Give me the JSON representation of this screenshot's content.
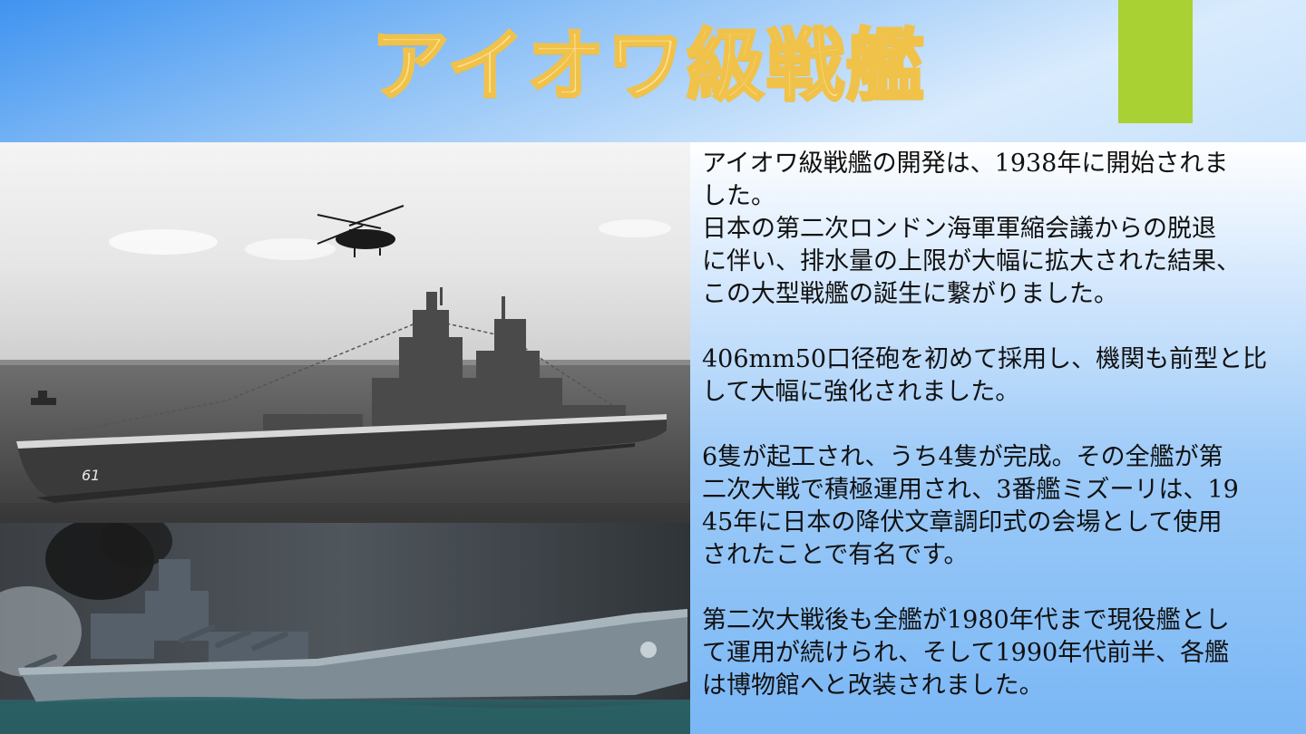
{
  "slide": {
    "title": "アイオワ級戦艦",
    "paragraphs": [
      [
        "アイオワ級戦艦の開発は、1938年に開始されま",
        "した。",
        "日本の第二次ロンドン海軍軍縮会議からの脱退",
        "に伴い、排水量の上限が大幅に拡大された結果、",
        "この大型戦艦の誕生に繋がりました。"
      ],
      [
        "406mm50口径砲を初めて採用し、機関も前型と比",
        "して大幅に強化されました。"
      ],
      [
        "6隻が起工され、うち4隻が完成。その全艦が第",
        "二次大戦で積極運用され、3番艦ミズーリは、19",
        "45年に日本の降伏文章調印式の会場として使用",
        "されたことで有名です。"
      ],
      [
        "第二次大戦後も全艦が1980年代まで現役艦とし",
        "て運用が続けられ、そして1990年代前半、各艦",
        "は博物館へと改装されました。"
      ]
    ],
    "photo_top": {
      "hull_number": "61"
    },
    "colors": {
      "title": "#fbe39a",
      "title_outline": "#f0c24a",
      "accent": "#a9d133"
    }
  }
}
